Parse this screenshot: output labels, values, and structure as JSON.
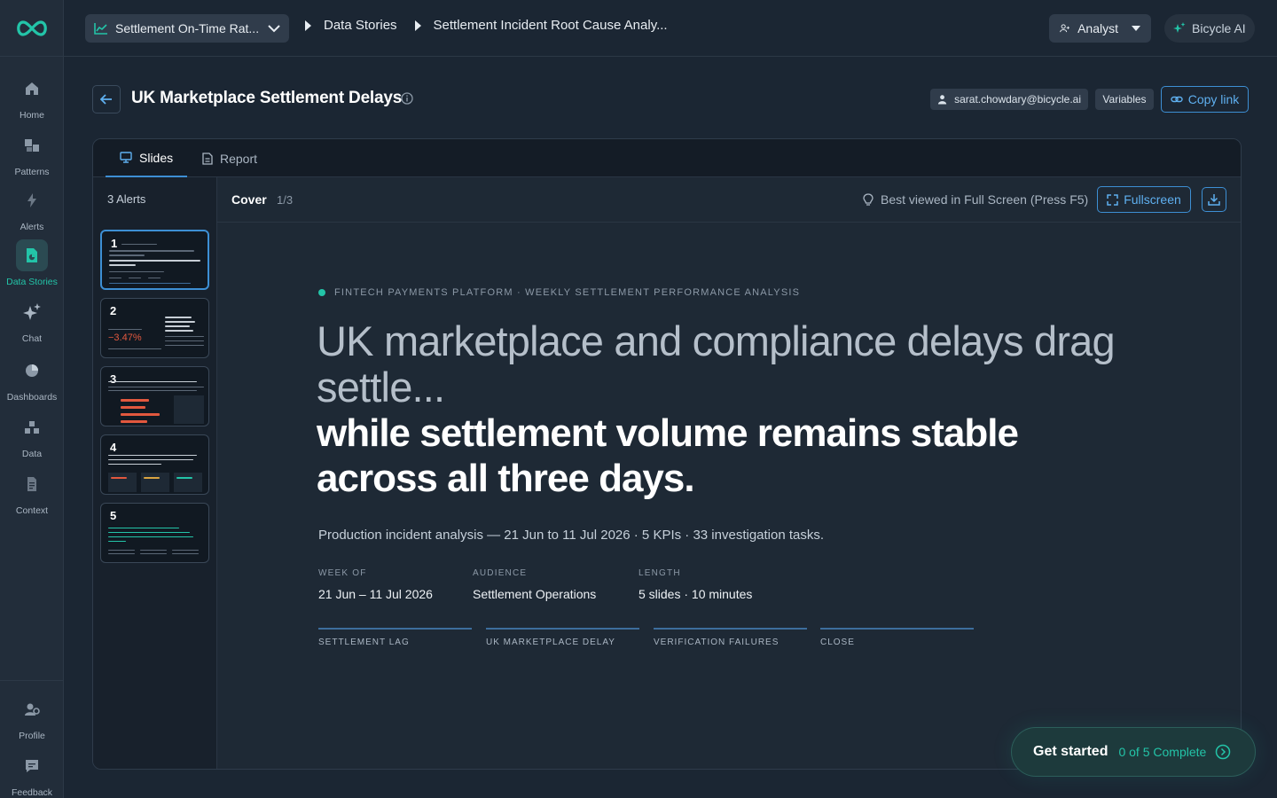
{
  "topbar": {
    "kpi_select": "Settlement On-Time Rat...",
    "breadcrumb": [
      "Data Stories",
      "Settlement Incident Root Cause Analy..."
    ],
    "role": "Analyst",
    "assistant": "Bicycle AI"
  },
  "rail": {
    "items": [
      {
        "label": "Home",
        "icon": "home-icon"
      },
      {
        "label": "Patterns",
        "icon": "patterns-icon"
      },
      {
        "label": "Alerts",
        "icon": "lightning-icon"
      },
      {
        "label": "Data Stories",
        "icon": "data-stories-icon"
      },
      {
        "label": "Chat",
        "icon": "sparkle-icon"
      },
      {
        "label": "Dashboards",
        "icon": "pie-icon"
      },
      {
        "label": "Data",
        "icon": "cubes-icon"
      },
      {
        "label": "Context",
        "icon": "document-icon"
      }
    ],
    "bottom": [
      {
        "label": "Profile",
        "icon": "user-gear-icon"
      },
      {
        "label": "Feedback",
        "icon": "chat-icon"
      }
    ]
  },
  "page": {
    "title": "UK Marketplace Settlement Delays",
    "user": "sarat.chowdary@bicycle.ai",
    "variables": "Variables",
    "copy_link": "Copy link"
  },
  "tabs": [
    "Slides",
    "Report"
  ],
  "thumbs": {
    "header": "3 Alerts",
    "numbers": [
      "1",
      "2",
      "3",
      "4",
      "5"
    ],
    "slide2_value": "−3.47%"
  },
  "slide_header": {
    "title": "Cover",
    "count": "1/3",
    "hint": "Best viewed in Full Screen (Press F5)",
    "fullscreen": "Fullscreen"
  },
  "slide": {
    "eyebrow": "FINTECH PAYMENTS PLATFORM · WEEKLY SETTLEMENT PERFORMANCE ANALYSIS",
    "headline_1": "UK marketplace and compliance delays drag settle...",
    "headline_2": "while settlement volume remains stable across all three days.",
    "subline": "Production incident analysis — 21 Jun to 11 Jul 2026 · 5 KPIs · 33 investigation tasks.",
    "meta": [
      {
        "label": "WEEK OF",
        "value": "21 Jun – 11 Jul 2026"
      },
      {
        "label": "AUDIENCE",
        "value": "Settlement Operations"
      },
      {
        "label": "LENGTH",
        "value": "5 slides · 10 minutes"
      }
    ],
    "sections": [
      "SETTLEMENT LAG",
      "UK MARKETPLACE DELAY",
      "VERIFICATION FAILURES",
      "CLOSE"
    ]
  },
  "get_started": {
    "label": "Get started",
    "progress": "0 of 5 Complete"
  },
  "colors": {
    "accent": "#3d8fd4",
    "teal": "#23c4a8",
    "negative": "#e2583e"
  }
}
